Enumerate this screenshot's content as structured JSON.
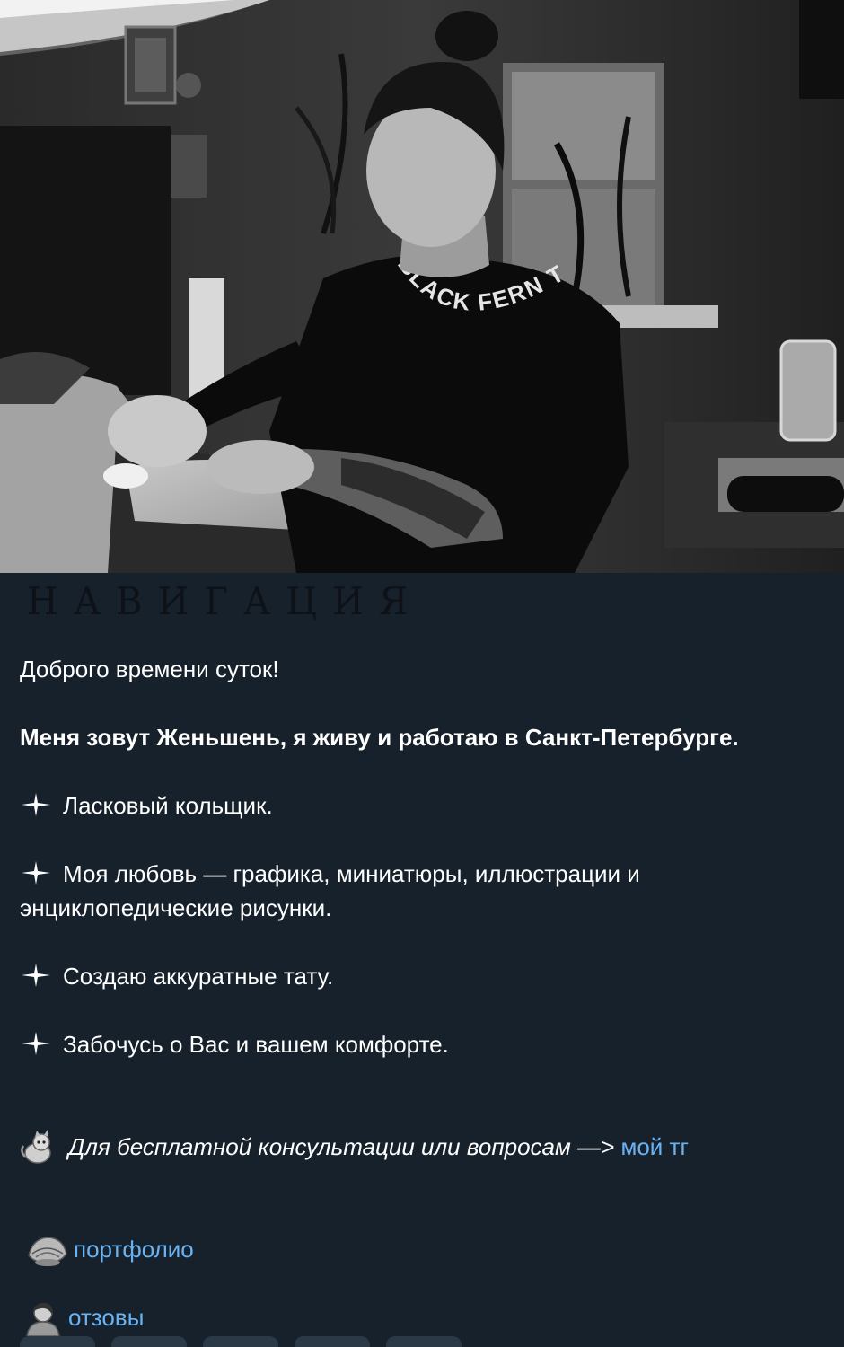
{
  "hero": {
    "shirt_text": "BLACK FERN TATTOO"
  },
  "nav_heading": "НАВИГАЦИЯ",
  "greeting": "Доброго времени суток!",
  "intro": "Меня зовут Женьшень, я живу и работаю в Санкт-Петербурге.",
  "features": [
    {
      "icon": "sparkle-icon",
      "line1": "Ласковый кольщик.",
      "line2": ""
    },
    {
      "icon": "sparkle-icon",
      "line1": "Моя любовь — графика, миниатюры, иллюстрации и",
      "line2": "энциклопедические рисунки."
    },
    {
      "icon": "sparkle-icon",
      "line1": "Создаю аккуратные тату.",
      "line2": ""
    },
    {
      "icon": "sparkle-icon",
      "line1": "Забочусь о Вас и вашем комфорте.",
      "line2": ""
    }
  ],
  "consult": {
    "icon": "cat-icon",
    "text": "Для бесплатной консультации или вопросам —> ",
    "link": "мой тг"
  },
  "links": {
    "portfolio": {
      "icon": "shell-icon",
      "label": "портфолио"
    },
    "reviews": {
      "icon": "person-icon",
      "label": "отзовы"
    }
  },
  "colors": {
    "background": "#17212b",
    "link": "#6ab3f3",
    "text": "#ffffff"
  }
}
